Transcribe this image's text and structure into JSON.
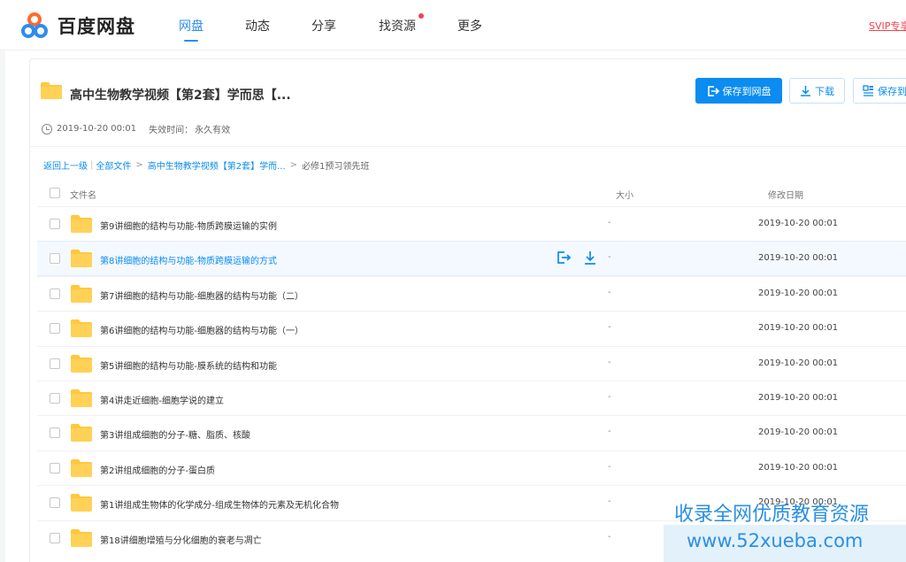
{
  "app": {
    "name": "百度网盘",
    "nav_tabs": [
      "网盘",
      "动态",
      "分享",
      "找资源",
      "更多"
    ],
    "active_tab": "网盘",
    "svip_label": "SVIP专享"
  },
  "share": {
    "title": "高中生物教学视频【第2套】学而思【...",
    "save_button": "保存到网盘",
    "download_button": "下载",
    "save_button_2": "保存到",
    "share_time": "2019-10-20 00:01",
    "expire_label": "失效时间：",
    "expire_value": "永久有效"
  },
  "breadcrumb": {
    "back": "返回上一级",
    "all_files": "全部文件",
    "parent": "高中生物教学视频【第2套】学而...",
    "current": "必修1预习领先班"
  },
  "table": {
    "headers": {
      "name": "文件名",
      "size": "大小",
      "modified": "修改日期"
    },
    "rows": [
      {
        "name": "第9讲细胞的结构与功能-物质跨膜运输的实例",
        "size": "-",
        "date": "2019-10-20 00:01"
      },
      {
        "name": "第8讲细胞的结构与功能-物质跨膜运输的方式",
        "size": "-",
        "date": "2019-10-20 00:01"
      },
      {
        "name": "第7讲细胞的结构与功能-细胞器的结构与功能（二）",
        "size": "-",
        "date": "2019-10-20 00:01"
      },
      {
        "name": "第6讲细胞的结构与功能-细胞器的结构与功能（一）",
        "size": "-",
        "date": "2019-10-20 00:01"
      },
      {
        "name": "第5讲细胞的结构与功能-膜系统的结构和功能",
        "size": "-",
        "date": "2019-10-20 00:01"
      },
      {
        "name": "第4讲走近细胞-细胞学说的建立",
        "size": "-",
        "date": "2019-10-20 00:01"
      },
      {
        "name": "第3讲组成细胞的分子-糖、脂质、核酸",
        "size": "-",
        "date": "2019-10-20 00:01"
      },
      {
        "name": "第2讲组成细胞的分子-蛋白质",
        "size": "-",
        "date": "2019-10-20 00:01"
      },
      {
        "name": "第1讲组成生物体的化学成分-组成生物体的元素及无机化合物",
        "size": "-",
        "date": "2019-10-20 00:01"
      },
      {
        "name": "第18讲细胞增殖与分化细胞的衰老与凋亡",
        "size": "-",
        "date": "2019-10-20 00:01"
      }
    ],
    "hover_row_index": 1
  },
  "watermark": {
    "line1": "收录全网优质教育资源",
    "line2": "www.52xueba.com"
  },
  "colors": {
    "accent": "#0a8cf0",
    "folder": "#ffc83d",
    "watermark": "#2a8fe4",
    "svip": "#f5414e"
  }
}
